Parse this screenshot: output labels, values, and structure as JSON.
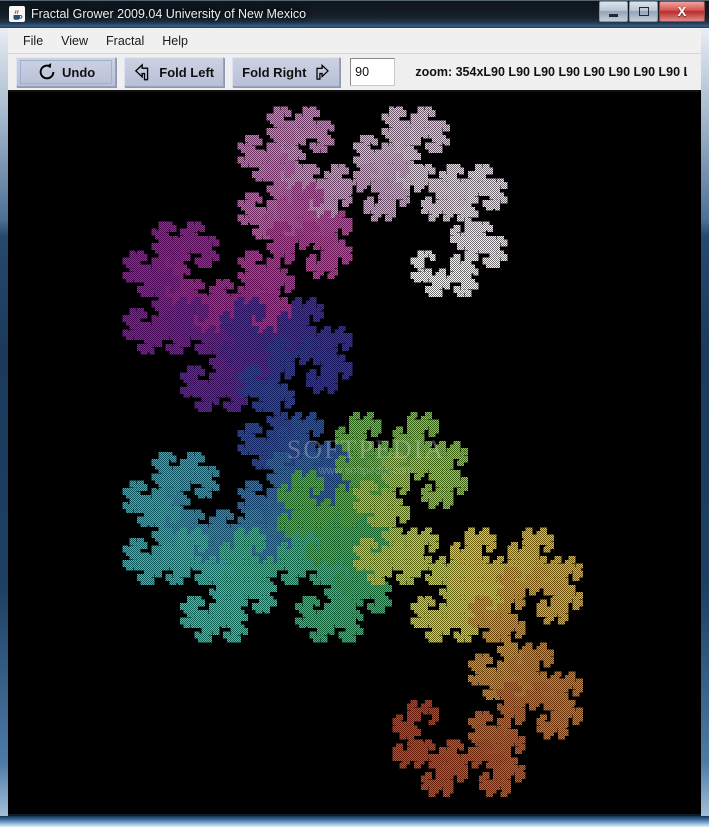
{
  "window": {
    "title": "Fractal Grower 2009.04 University of New Mexico",
    "app_icon": "java-coffee-cup-icon",
    "controls": {
      "minimize": "minimize-icon",
      "maximize": "maximize-icon",
      "close": "X"
    }
  },
  "menubar": {
    "items": [
      {
        "label": "File"
      },
      {
        "label": "View"
      },
      {
        "label": "Fractal"
      },
      {
        "label": "Help"
      }
    ]
  },
  "toolbar": {
    "undo_label": "Undo",
    "undo_icon": "undo-circular-arrow-icon",
    "fold_left_label": "Fold Left",
    "fold_left_icon": "arrow-left-icon",
    "fold_right_label": "Fold Right",
    "fold_right_icon": "arrow-right-icon",
    "angle_value": "90",
    "angle_placeholder": "90",
    "zoom_label": "zoom: 354x",
    "zoom_value": "354x",
    "sequence_label": "L90 L90 L90 L90 L90 L90 L90 L90 L..."
  },
  "canvas": {
    "background_color": "#000000",
    "fractal_name": "dragon-curve",
    "iterations": 14,
    "turn_angle_degrees": 90,
    "axiom_turn": "L",
    "palette": [
      "#ffffff",
      "#f2d9f2",
      "#e9a8e4",
      "#ef6fd9",
      "#f02ec0",
      "#d315c0",
      "#a410c4",
      "#6a1ecf",
      "#3531d6",
      "#1f5be0",
      "#1f8fe0",
      "#19bcd6",
      "#18d9c2",
      "#17d894",
      "#1ccf5a",
      "#3fd02d",
      "#86dd27",
      "#c8e021",
      "#f2d314",
      "#f5a810",
      "#f3770e",
      "#ef4a12",
      "#e22512"
    ],
    "dot_size": 2,
    "watermark": {
      "title": "SOFTPEDIA",
      "subtitle": "www.softpedia.com"
    }
  }
}
